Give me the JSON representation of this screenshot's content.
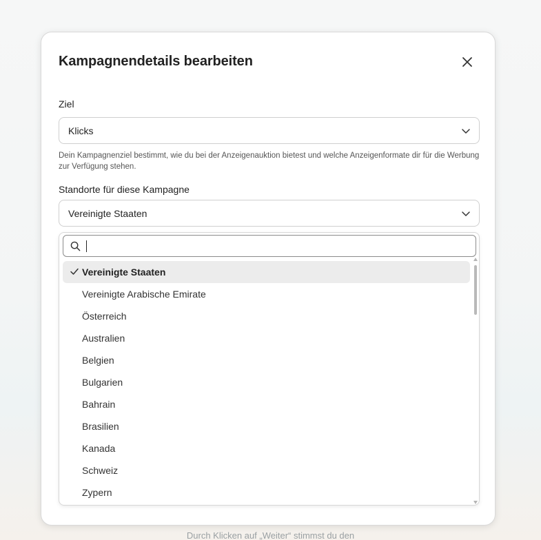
{
  "backdrop": {
    "footer_text": "Durch Klicken auf „Weiter“ stimmst du den"
  },
  "modal": {
    "title": "Kampagnendetails bearbeiten",
    "close_icon": "close-icon"
  },
  "goal": {
    "label": "Ziel",
    "value": "Klicks",
    "help": "Dein Kampagnenziel bestimmt, wie du bei der Anzeigenauktion bietest und welche Anzeigenformate dir für die Werbung zur Verfügung stehen."
  },
  "locations": {
    "label": "Standorte für diese Kampagne",
    "value": "Vereinigte Staaten",
    "search": {
      "value": "",
      "icon": "search-icon"
    },
    "options": [
      {
        "label": "Vereinigte Staaten",
        "selected": true
      },
      {
        "label": "Vereinigte Arabische Emirate",
        "selected": false
      },
      {
        "label": "Österreich",
        "selected": false
      },
      {
        "label": "Australien",
        "selected": false
      },
      {
        "label": "Belgien",
        "selected": false
      },
      {
        "label": "Bulgarien",
        "selected": false
      },
      {
        "label": "Bahrain",
        "selected": false
      },
      {
        "label": "Brasilien",
        "selected": false
      },
      {
        "label": "Kanada",
        "selected": false
      },
      {
        "label": "Schweiz",
        "selected": false
      },
      {
        "label": "Zypern",
        "selected": false
      }
    ]
  },
  "colors": {
    "selected_bg": "#ececec",
    "border": "#cfcfcf",
    "text": "#222222"
  }
}
